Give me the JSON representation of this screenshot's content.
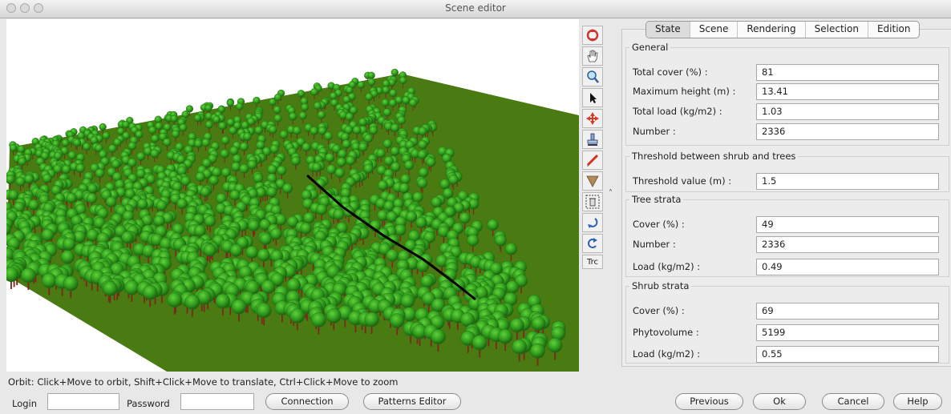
{
  "window": {
    "title": "Scene editor"
  },
  "viewport": {
    "description_icon": "forest-scene-3d",
    "colors": {
      "canopy": "#2f9a1c",
      "canopy_dark": "#1f6f12",
      "ground": "#4a7a12",
      "trunk": "#7a2a1a",
      "gap": "#000000"
    }
  },
  "toolbar": {
    "tools": [
      {
        "icon": "orbit-icon"
      },
      {
        "icon": "hand-icon"
      },
      {
        "icon": "zoom-icon"
      },
      {
        "icon": "pointer-icon"
      },
      {
        "icon": "pan-icon"
      },
      {
        "icon": "stamp-icon"
      },
      {
        "icon": "pencil-icon"
      },
      {
        "icon": "funnel-icon"
      },
      {
        "icon": "trash-icon"
      },
      {
        "icon": "undo-icon"
      },
      {
        "icon": "redo-icon"
      }
    ],
    "trc_label": "Trc"
  },
  "tabs": [
    "State",
    "Scene",
    "Rendering",
    "Selection",
    "Edition"
  ],
  "active_tab": "State",
  "general": {
    "title": "General",
    "total_cover_label": "Total cover (%) :",
    "total_cover_value": "81",
    "max_height_label": "Maximum height (m) :",
    "max_height_value": "13.41",
    "total_load_label": "Total load (kg/m2) :",
    "total_load_value": "1.03",
    "number_label": "Number :",
    "number_value": "2336"
  },
  "threshold": {
    "title": "Threshold between shrub and trees",
    "value_label": "Threshold value (m) :",
    "value": "1.5"
  },
  "tree_strata": {
    "title": "Tree strata",
    "cover_label": "Cover (%) :",
    "cover_value": "49",
    "number_label": "Number :",
    "number_value": "2336",
    "load_label": "Load (kg/m2) :",
    "load_value": "0.49"
  },
  "shrub_strata": {
    "title": "Shrub strata",
    "cover_label": "Cover (%) :",
    "cover_value": "69",
    "phyto_label": "Phytovolume :",
    "phyto_value": "5199",
    "load_label": "Load (kg/m2) :",
    "load_value": "0.55"
  },
  "status_text": "Orbit: Click+Move to orbit, Shift+Click+Move to translate, Ctrl+Click+Move to zoom",
  "bottom": {
    "login_label": "Login",
    "login_value": "",
    "password_label": "Password",
    "password_value": "",
    "connection_label": "Connection",
    "patterns_label": "Patterns Editor",
    "previous_label": "Previous",
    "ok_label": "Ok",
    "cancel_label": "Cancel",
    "help_label": "Help"
  }
}
